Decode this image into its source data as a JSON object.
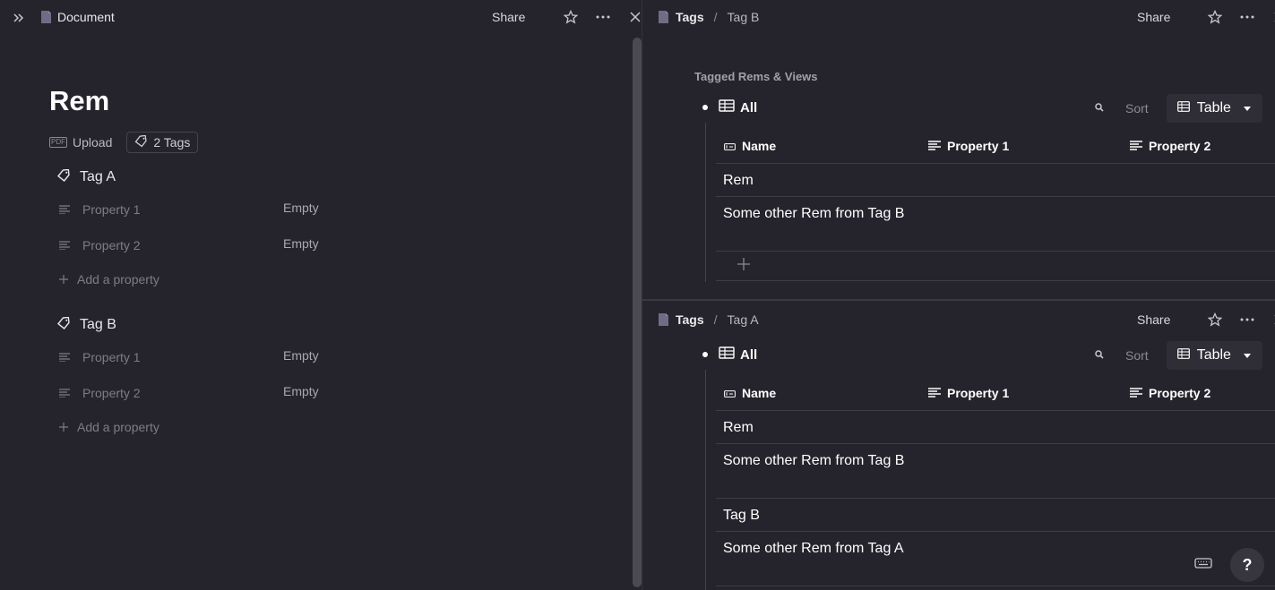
{
  "left_pane": {
    "breadcrumb": "Document",
    "share_label": "Share",
    "title": "Rem",
    "upload_label": "Upload",
    "pdf_badge": "PDF",
    "tags_label": "2 Tags",
    "tags": [
      {
        "name": "Tag A",
        "properties": [
          {
            "name": "Property 1",
            "value": "Empty"
          },
          {
            "name": "Property 2",
            "value": "Empty"
          }
        ],
        "add_property_label": "Add a property"
      },
      {
        "name": "Tag B",
        "properties": [
          {
            "name": "Property 1",
            "value": "Empty"
          },
          {
            "name": "Property 2",
            "value": "Empty"
          }
        ],
        "add_property_label": "Add a property"
      }
    ]
  },
  "top_right_pane": {
    "breadcrumb_root": "Tags",
    "breadcrumb_separator": "/",
    "breadcrumb_current": "Tag B",
    "share_label": "Share",
    "section_label": "Tagged Rems & Views",
    "view_name": "All",
    "sort_label": "Sort",
    "view_type_label": "Table",
    "columns": [
      "Name",
      "Property 1",
      "Property 2"
    ],
    "rows": [
      "Rem",
      "Some other Rem from Tag B"
    ]
  },
  "bottom_right_pane": {
    "breadcrumb_root": "Tags",
    "breadcrumb_separator": "/",
    "breadcrumb_current": "Tag A",
    "share_label": "Share",
    "view_name": "All",
    "sort_label": "Sort",
    "view_type_label": "Table",
    "columns": [
      "Name",
      "Property 1",
      "Property 2"
    ],
    "rows": [
      "Rem",
      "Some other Rem from Tag B",
      "Tag B",
      "Some other Rem from Tag A"
    ]
  },
  "help_label": "?",
  "icons": {
    "expand": "double-chevron-right-icon",
    "page": "page-icon",
    "star": "star-icon",
    "more": "more-dots-icon",
    "close": "close-icon",
    "tag": "tag-icon",
    "lines": "text-lines-icon",
    "plus": "plus-icon",
    "table": "table-icon",
    "search": "search-icon",
    "keyboard": "keyboard-icon"
  }
}
